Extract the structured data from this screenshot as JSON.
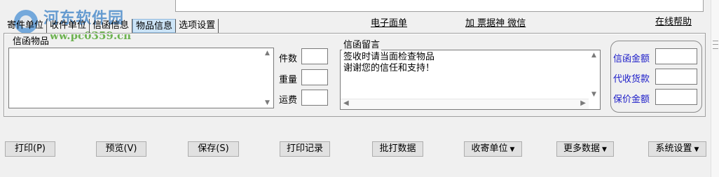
{
  "watermark": {
    "title": "河东软件园",
    "url": "www.pc0359.cn"
  },
  "tabs": [
    {
      "label": "寄件单位",
      "active": false
    },
    {
      "label": "收件单位",
      "active": false
    },
    {
      "label": "信函信息",
      "active": false
    },
    {
      "label": "物品信息",
      "active": true
    },
    {
      "label": "选项设置",
      "active": false
    }
  ],
  "links": {
    "electronic_waybill": "电子面单",
    "add_wechat": "加 票据神 微信",
    "online_help": "在线帮助"
  },
  "letter_items": {
    "label": "信函物品",
    "value": ""
  },
  "item_fields": {
    "count_label": "件数",
    "count_value": "",
    "weight_label": "重量",
    "weight_value": "",
    "freight_label": "运费",
    "freight_value": ""
  },
  "message": {
    "label": "信函留言",
    "lines": [
      "签收时请当面检查物品",
      "谢谢您的信任和支持！"
    ]
  },
  "amounts": {
    "letter_amount_label": "信函金额",
    "letter_amount_value": "",
    "cod_label": "代收货款",
    "cod_value": "",
    "insured_label": "保价金额",
    "insured_value": ""
  },
  "buttons": {
    "print": "打印(P)",
    "preview": "预览(V)",
    "save": "保存(S)",
    "print_log": "打印记录",
    "batch_print": "批打数据",
    "recipient_unit": "收寄单位",
    "more_data": "更多数据",
    "system_settings": "系统设置"
  },
  "colors": {
    "tab_active_bg": "#cce4f7",
    "amount_label": "#1a1ac8",
    "watermark_blue": "#3f84c8",
    "watermark_green": "#57a836"
  },
  "icons": {
    "dropdown": "triangle-down-icon",
    "scroll_up": "triangle-up-icon",
    "scroll_down": "triangle-down-icon"
  }
}
